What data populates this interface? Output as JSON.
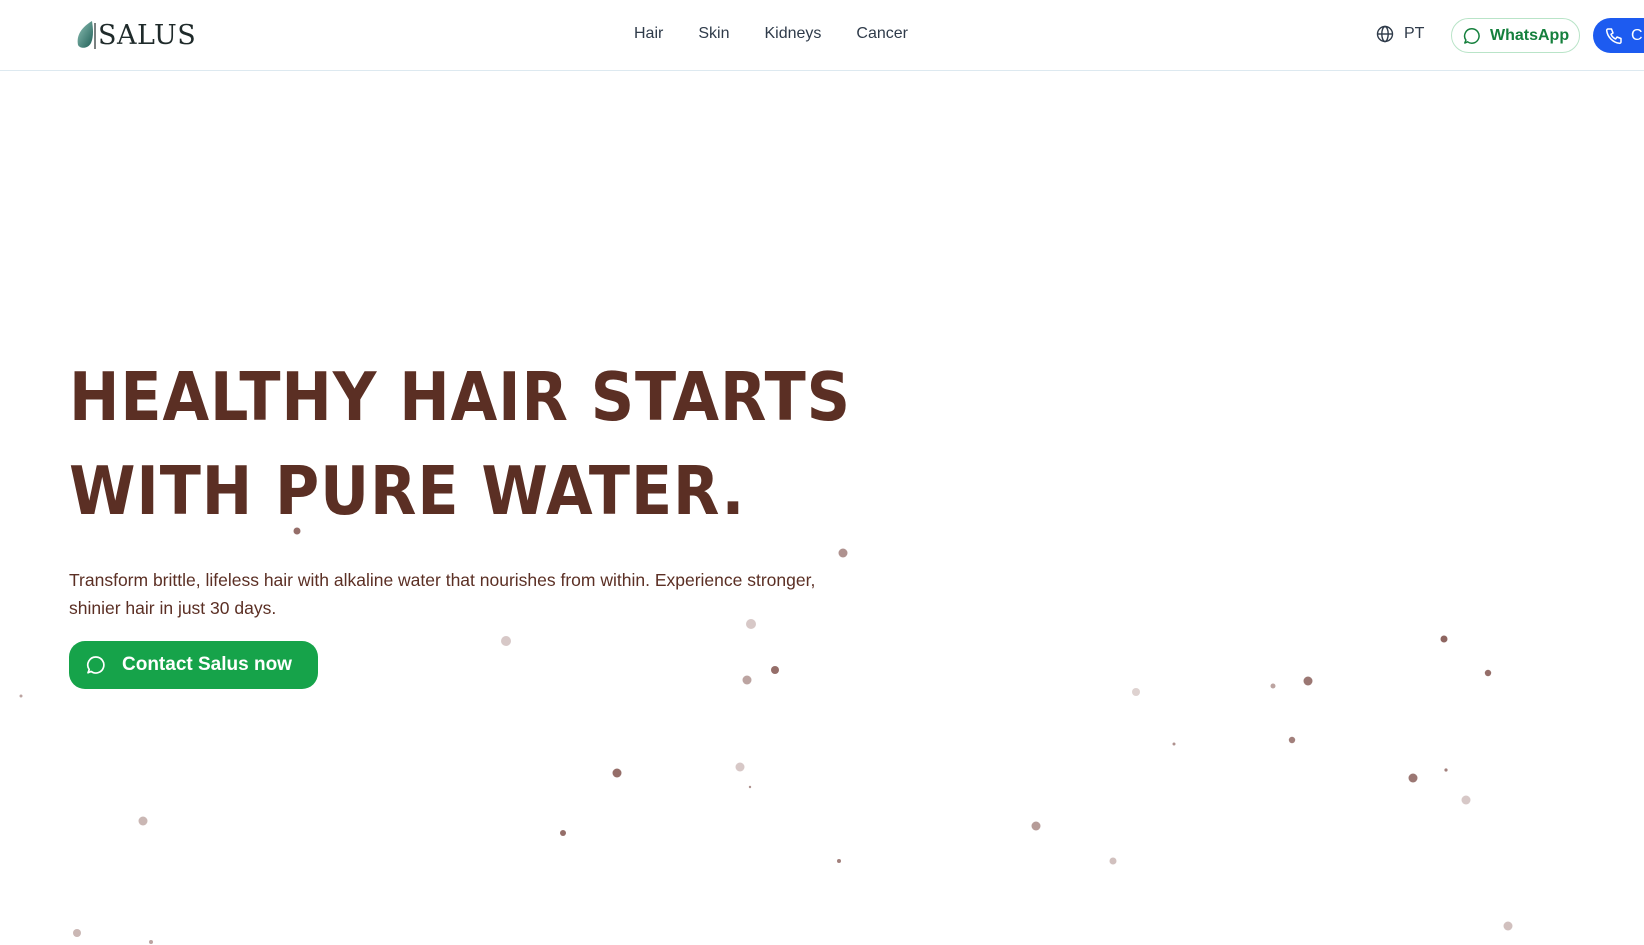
{
  "header": {
    "logo_text": "SALUS",
    "nav": [
      {
        "label": "Hair"
      },
      {
        "label": "Skin"
      },
      {
        "label": "Kidneys"
      },
      {
        "label": "Cancer"
      }
    ],
    "language": "PT",
    "whatsapp_label": "WhatsApp",
    "call_label": "C"
  },
  "hero": {
    "title_line1": "HEALTHY HAIR STARTS",
    "title_line2": "WITH PURE WATER.",
    "description": "Transform brittle, lifeless hair with alkaline water that nourishes from within. Experience stronger, shinier hair in just 30 days.",
    "cta_label": "Contact Salus now"
  },
  "colors": {
    "brand_brown": "#5b2f24",
    "whatsapp_green": "#16a34a",
    "call_blue": "#1d5bf0",
    "logo_teal": "#2e7d72"
  },
  "icons": {
    "language": "globe-icon",
    "whatsapp": "chat-bubble-icon",
    "call": "phone-icon",
    "cta": "chat-bubble-icon"
  }
}
